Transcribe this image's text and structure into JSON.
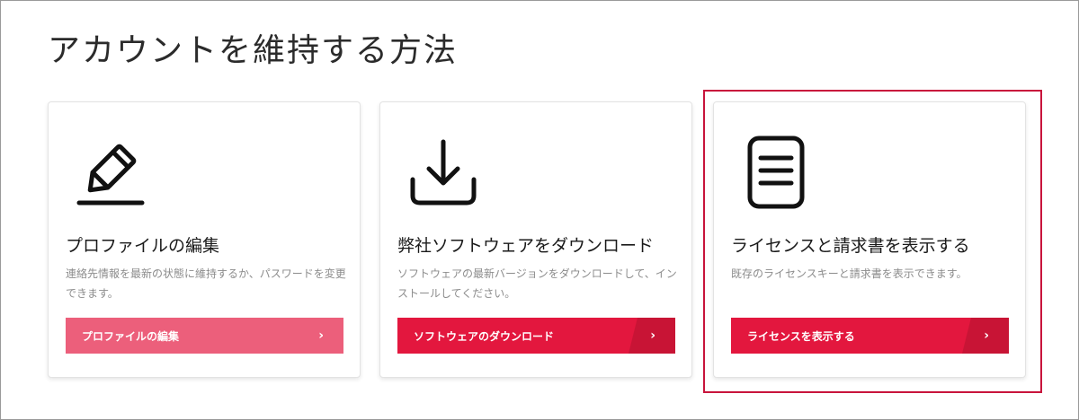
{
  "page": {
    "title": "アカウントを維持する方法"
  },
  "cards": [
    {
      "icon": "pencil-icon",
      "title": "プロファイルの編集",
      "description": "連絡先情報を最新の状態に維持するか、パスワードを変更できます。",
      "button_label": "プロファイルの編集",
      "button_arrow": "›"
    },
    {
      "icon": "download-icon",
      "title": "弊社ソフトウェアをダウンロード",
      "description": "ソフトウェアの最新バージョンをダウンロードして、インストールしてください。",
      "button_label": "ソフトウェアのダウンロード",
      "button_arrow": "›"
    },
    {
      "icon": "document-icon",
      "title": "ライセンスと請求書を表示する",
      "description": "既存のライセンスキーと請求書を表示できます。",
      "button_label": "ライセンスを表示する",
      "button_arrow": "›"
    }
  ],
  "colors": {
    "accent": "#e3173e",
    "accent_light": "#ec5f7b",
    "accent_dark": "#c81435",
    "highlight": "#c8143c",
    "title_text": "#2b2b2b",
    "body_text": "#8c8c8c"
  }
}
